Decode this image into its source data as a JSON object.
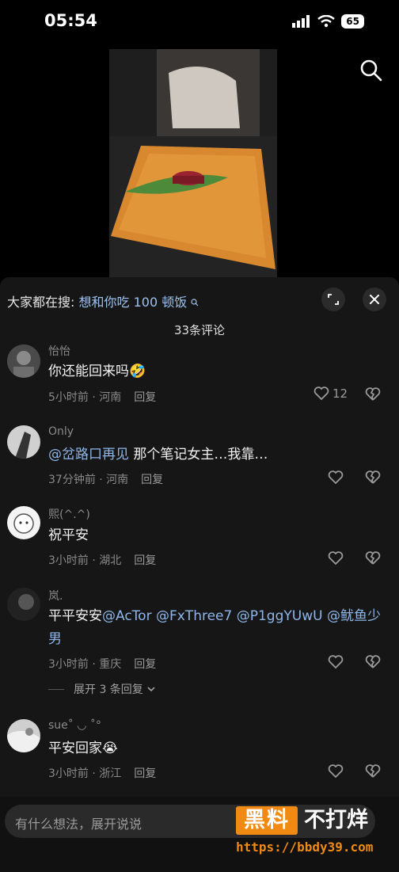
{
  "status_bar": {
    "time": "05:54",
    "battery": "65"
  },
  "search_panel": {
    "trend_prefix": "大家都在搜:",
    "trend_keyword": "想和你吃 100 顿饭",
    "comment_count_label": "33条评论"
  },
  "comments": [
    {
      "name": "怡怡",
      "text": "你还能回来吗",
      "emoji": "🤣",
      "time_location": "5小时前 · 河南",
      "reply_label": "回复",
      "likes": "12"
    },
    {
      "name": "Only",
      "mention": "@岔路口再见",
      "text": " 那个笔记女主…我靠…",
      "time_location": "37分钟前 · 河南",
      "reply_label": "回复"
    },
    {
      "name": "熙(^.^)",
      "text": "祝平安",
      "time_location": "3小时前 · 湖北",
      "reply_label": "回复"
    },
    {
      "name": "岚.",
      "text": "平平安安",
      "mentions": "@AcTor @FxThree7 @P1ggYUwU @鱿鱼少男",
      "time_location": "3小时前 · 重庆",
      "reply_label": "回复",
      "expand_label": "展开 3 条回复"
    },
    {
      "name": "sue˚ ◡ ˚°",
      "text": "平安回家",
      "emoji": "😭",
      "time_location": "3小时前 · 浙江",
      "reply_label": "回复"
    }
  ],
  "input_bar": {
    "placeholder": "有什么想法，展开说说"
  },
  "watermark": {
    "boxed": "黑料",
    "text": "不打烊",
    "url": "https://bbdy39.com"
  },
  "colors": {
    "mention": "#8db6ea",
    "sheet_bg": "#161616",
    "watermark_orange": "#f08a12"
  }
}
